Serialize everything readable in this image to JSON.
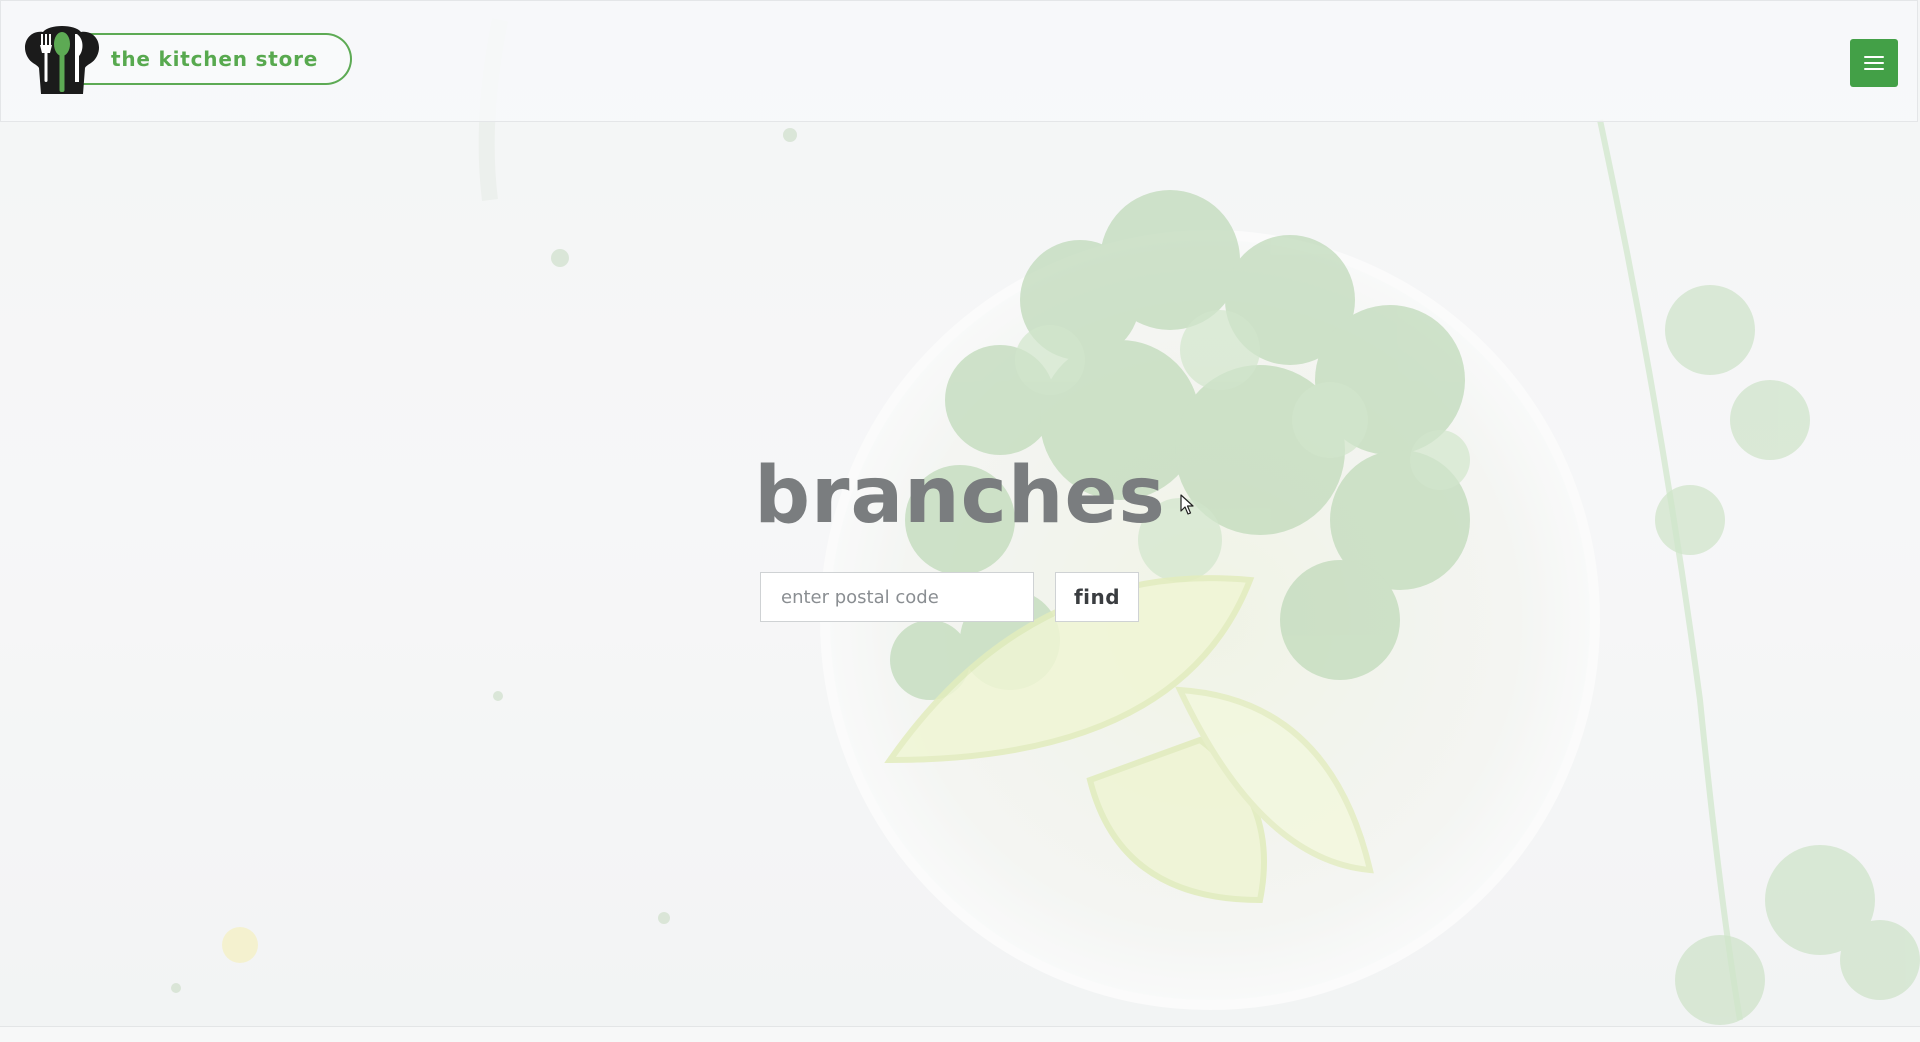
{
  "header": {
    "brand_name": "the kitchen store",
    "logo_icon": "chef-hat-cutlery-logo",
    "menu_icon": "hamburger-menu-icon",
    "menu_button_color": "#43a047"
  },
  "hero": {
    "title": "branches",
    "background_image": "cilantro-and-lime-bowl",
    "search": {
      "placeholder": "enter postal code",
      "value": "",
      "button_label": "find"
    }
  },
  "colors": {
    "brand_green": "#58a94f",
    "title_gray": "#7a7d7f"
  }
}
